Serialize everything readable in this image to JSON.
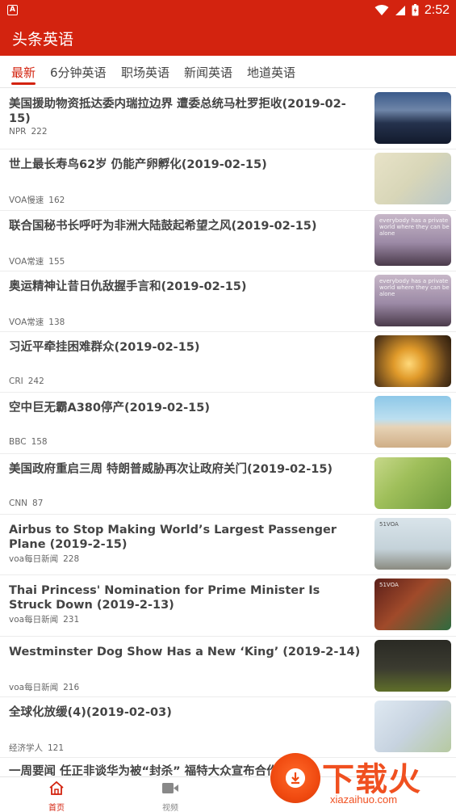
{
  "status_bar": {
    "time": "2:52",
    "app_icon_letter": "A"
  },
  "app_bar": {
    "title": "头条英语"
  },
  "tabs": [
    {
      "label": "最新",
      "active": true
    },
    {
      "label": "6分钟英语",
      "active": false
    },
    {
      "label": "职场英语",
      "active": false
    },
    {
      "label": "新闻英语",
      "active": false
    },
    {
      "label": "地道英语",
      "active": false
    }
  ],
  "articles": [
    {
      "title": "美国援助物资抵达委内瑞拉边界 遭委总统马杜罗拒收(2019-02-15)",
      "source": "NPR",
      "count": "222"
    },
    {
      "title": "世上最长寿鸟62岁 仍能产卵孵化(2019-02-15)",
      "source": "VOA慢速",
      "count": "162"
    },
    {
      "title": "联合国秘书长呼吁为非洲大陆鼓起希望之风(2019-02-15)",
      "source": "VOA常速",
      "count": "155",
      "thumb_caption": "everybody has a private world where they can be alone"
    },
    {
      "title": "奥运精神让昔日仇敌握手言和(2019-02-15)",
      "source": "VOA常速",
      "count": "138",
      "thumb_caption": "everybody has a private world where they can be alone"
    },
    {
      "title": "习近平牵挂困难群众(2019-02-15)",
      "source": "CRI",
      "count": "242"
    },
    {
      "title": "空中巨无霸A380停产(2019-02-15)",
      "source": "BBC",
      "count": "158"
    },
    {
      "title": "美国政府重启三周 特朗普威胁再次让政府关门(2019-02-15)",
      "source": "CNN",
      "count": "87"
    },
    {
      "title": "Airbus to Stop Making World’s Largest Passenger Plane (2019-2-15)",
      "source": "voa每日新闻",
      "count": "228",
      "thumb_caption": "51VOA"
    },
    {
      "title": "Thai Princess' Nomination for Prime Minister Is Struck Down (2019-2-13)",
      "source": "voa每日新闻",
      "count": "231",
      "thumb_caption": "51VOA"
    },
    {
      "title": "Westminster Dog Show Has a New ‘King’ (2019-2-14)",
      "source": "voa每日新闻",
      "count": "216"
    },
    {
      "title": "全球化放缓(4)(2019-02-03)",
      "source": "经济学人",
      "count": "121"
    }
  ],
  "partial_article_title": "一周要闻 任正非谈华为被“封杀” 福特大众宣布合作",
  "bottom_nav": [
    {
      "label": "首页",
      "icon": "home-icon",
      "active": true
    },
    {
      "label": "视频",
      "icon": "video-icon",
      "active": false
    }
  ],
  "watermark": {
    "text": "下载火",
    "url": "xiazaihuo.com"
  },
  "colors": {
    "primary": "#d3230f",
    "text": "#444444",
    "meta": "#666666"
  }
}
